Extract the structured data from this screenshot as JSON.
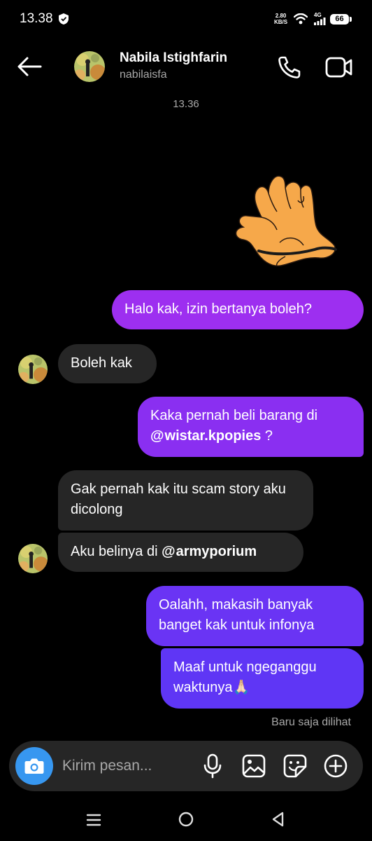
{
  "status_bar": {
    "time": "13.38",
    "net_speed_value": "2.80",
    "net_speed_unit": "KB/S",
    "network_type": "4G",
    "battery": "66"
  },
  "header": {
    "contact_name": "Nabila Istighfarin",
    "username": "nabilaisfa",
    "icons": [
      "back-arrow-icon",
      "phone-icon",
      "video-camera-icon"
    ]
  },
  "chat": {
    "timestamp": "13.36",
    "sticker": "hand-sticker",
    "messages": [
      {
        "dir": "out",
        "text": "Halo kak, izin bertanya boleh?"
      },
      {
        "dir": "in",
        "text": "Boleh kak"
      },
      {
        "dir": "out",
        "text_before": "Kaka pernah beli barang di",
        "mention": "wistar.kpopies",
        "text_after": " ?"
      },
      {
        "dir": "in",
        "text": "Gak pernah kak itu scam story aku dicolong"
      },
      {
        "dir": "in",
        "text_before": "Aku belinya di ",
        "mention": "armyporium"
      },
      {
        "dir": "out",
        "text": "Oalahh, makasih banyak banget kak untuk infonya"
      },
      {
        "dir": "out",
        "text": "Maaf untuk ngeganggu waktunya🙏🏻"
      }
    ],
    "seen_label": "Baru saja dilihat"
  },
  "composer": {
    "placeholder": "Kirim pesan..."
  },
  "colors": {
    "background": "#000000",
    "incoming_bubble": "#262626",
    "outgoing_bubble": "#7b2cf0",
    "camera_button": "#3797f0"
  }
}
